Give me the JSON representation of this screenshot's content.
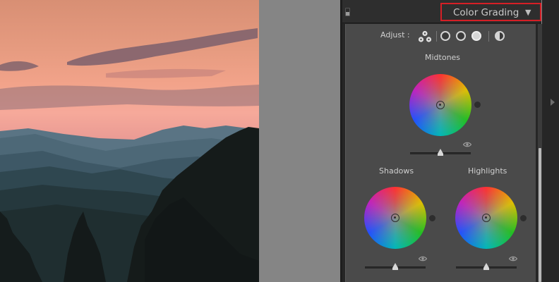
{
  "panel": {
    "title": "Color Grading",
    "collapse_glyph": "▼",
    "adjust_label": "Adjust :",
    "midtones_label": "Midtones",
    "shadows_label": "Shadows",
    "highlights_label": "Highlights"
  },
  "icons": {
    "panel_switch": "panel-switch-icon",
    "collapse": "triangle-down-icon",
    "three_way": "three-way-wheels-icon",
    "shadows_mode": "circle-outline-icon",
    "midtones_mode": "circle-outline-icon",
    "highlights_mode": "filled-circle-icon",
    "global_mode": "half-circle-icon",
    "visibility": "eye-icon",
    "expand_right": "chevron-right-icon"
  },
  "colors": {
    "highlight_box": "#d61f26",
    "panel_bg": "#4a4a4a",
    "header_bg": "#2e2e2e"
  },
  "sliders": {
    "midtones_luminance": 0.5,
    "shadows_luminance": 0.5,
    "highlights_luminance": 0.5
  }
}
